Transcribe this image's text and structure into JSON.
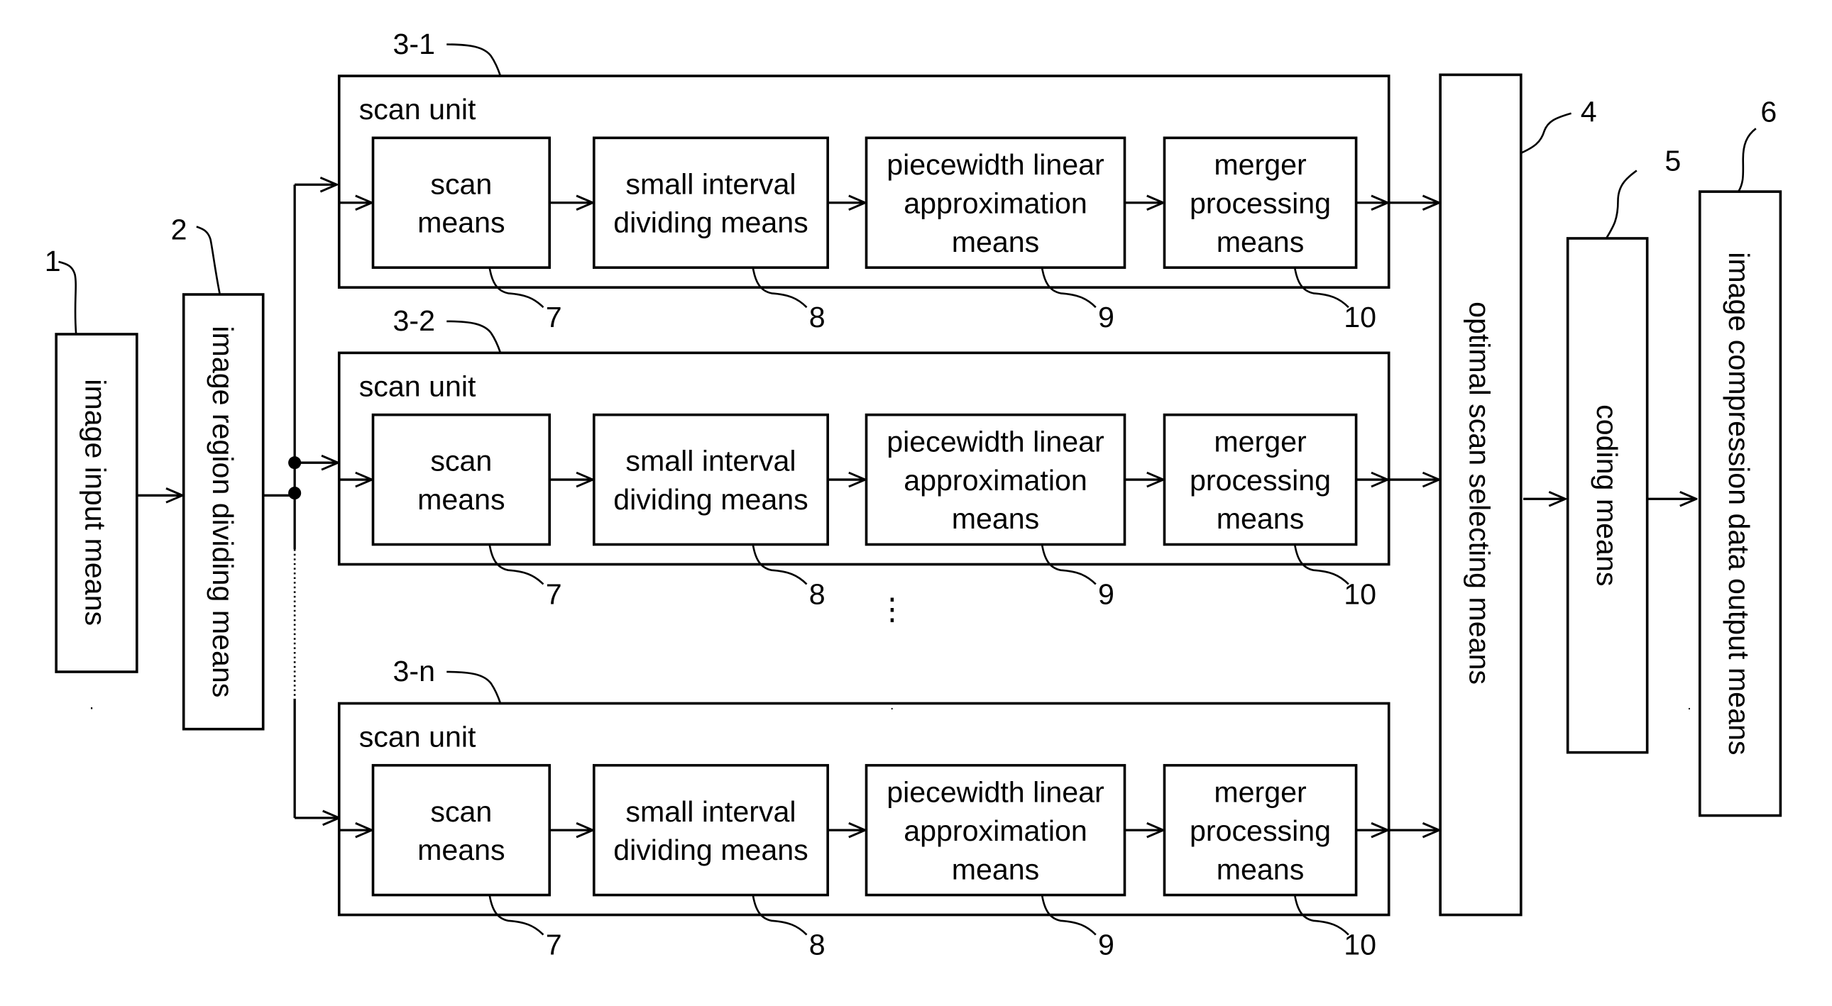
{
  "diagram": {
    "title": "",
    "blocks": {
      "image_input": {
        "ref": "1",
        "label": "image input means"
      },
      "region_dividing": {
        "ref": "2",
        "label": "image region dividing means"
      },
      "optimal_scan": {
        "ref": "4",
        "label": "optimal scan selecting means"
      },
      "coding": {
        "ref": "5",
        "label": "coding means"
      },
      "output": {
        "ref": "6",
        "label": "image compression data output means"
      }
    },
    "scan_units": [
      {
        "ref": "3-1",
        "title": "scan unit",
        "stages": [
          {
            "ref": "7",
            "lines": [
              "scan",
              "means"
            ]
          },
          {
            "ref": "8",
            "lines": [
              "small interval",
              "dividing means"
            ]
          },
          {
            "ref": "9",
            "lines": [
              "piecewidth linear",
              "approximation",
              "means"
            ]
          },
          {
            "ref": "10",
            "lines": [
              "merger",
              "processing",
              "means"
            ]
          }
        ]
      },
      {
        "ref": "3-2",
        "title": "scan unit",
        "stages": [
          {
            "ref": "7",
            "lines": [
              "scan",
              "means"
            ]
          },
          {
            "ref": "8",
            "lines": [
              "small interval",
              "dividing means"
            ]
          },
          {
            "ref": "9",
            "lines": [
              "piecewidth linear",
              "approximation",
              "means"
            ]
          },
          {
            "ref": "10",
            "lines": [
              "merger",
              "processing",
              "means"
            ]
          }
        ]
      },
      {
        "ref": "3-n",
        "title": "scan unit",
        "stages": [
          {
            "ref": "7",
            "lines": [
              "scan",
              "means"
            ]
          },
          {
            "ref": "8",
            "lines": [
              "small interval",
              "dividing means"
            ]
          },
          {
            "ref": "9",
            "lines": [
              "piecewidth linear",
              "approximation",
              "means"
            ]
          },
          {
            "ref": "10",
            "lines": [
              "merger",
              "processing",
              "means"
            ]
          }
        ]
      }
    ],
    "ellipsis": "⋮"
  }
}
